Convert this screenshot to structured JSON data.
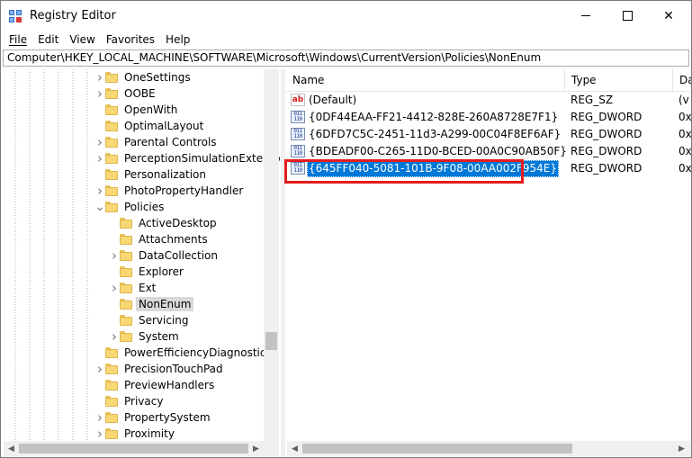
{
  "window": {
    "title": "Registry Editor",
    "icons": {
      "app": "registry-editor-icon",
      "minimize": "minimize-icon",
      "maximize": "maximize-icon",
      "close": "close-icon"
    },
    "close_glyph": "✕"
  },
  "menu": {
    "items": [
      {
        "label": "File",
        "key": "F"
      },
      {
        "label": "Edit",
        "key": "E"
      },
      {
        "label": "View",
        "key": "V"
      },
      {
        "label": "Favorites",
        "key": "a"
      },
      {
        "label": "Help",
        "key": "H"
      }
    ]
  },
  "address": {
    "path": "Computer\\HKEY_LOCAL_MACHINE\\SOFTWARE\\Microsoft\\Windows\\CurrentVersion\\Policies\\NonEnum"
  },
  "tree": {
    "items": [
      {
        "label": "OneSettings",
        "depth": 0,
        "expander": "right"
      },
      {
        "label": "OOBE",
        "depth": 0,
        "expander": "right"
      },
      {
        "label": "OpenWith",
        "depth": 0,
        "expander": "none"
      },
      {
        "label": "OptimalLayout",
        "depth": 0,
        "expander": "none"
      },
      {
        "label": "Parental Controls",
        "depth": 0,
        "expander": "right"
      },
      {
        "label": "PerceptionSimulationExtensions",
        "depth": 0,
        "expander": "right"
      },
      {
        "label": "Personalization",
        "depth": 0,
        "expander": "none"
      },
      {
        "label": "PhotoPropertyHandler",
        "depth": 0,
        "expander": "right"
      },
      {
        "label": "Policies",
        "depth": 0,
        "expander": "down"
      },
      {
        "label": "ActiveDesktop",
        "depth": 1,
        "expander": "none"
      },
      {
        "label": "Attachments",
        "depth": 1,
        "expander": "none"
      },
      {
        "label": "DataCollection",
        "depth": 1,
        "expander": "right"
      },
      {
        "label": "Explorer",
        "depth": 1,
        "expander": "none"
      },
      {
        "label": "Ext",
        "depth": 1,
        "expander": "right"
      },
      {
        "label": "NonEnum",
        "depth": 1,
        "expander": "none",
        "selected": true
      },
      {
        "label": "Servicing",
        "depth": 1,
        "expander": "none"
      },
      {
        "label": "System",
        "depth": 1,
        "expander": "right"
      },
      {
        "label": "PowerEfficiencyDiagnostics",
        "depth": 0,
        "expander": "none"
      },
      {
        "label": "PrecisionTouchPad",
        "depth": 0,
        "expander": "right"
      },
      {
        "label": "PreviewHandlers",
        "depth": 0,
        "expander": "none"
      },
      {
        "label": "Privacy",
        "depth": 0,
        "expander": "none"
      },
      {
        "label": "PropertySystem",
        "depth": 0,
        "expander": "right"
      },
      {
        "label": "Proximity",
        "depth": 0,
        "expander": "right"
      }
    ]
  },
  "list": {
    "columns": [
      "Name",
      "Type",
      "Da"
    ],
    "rows": [
      {
        "name": "(Default)",
        "type": "REG_SZ",
        "data": "(v",
        "icon": "string-value-icon",
        "icon_text": "ab"
      },
      {
        "name": "{0DF44EAA-FF21-4412-828E-260A8728E7F1}",
        "type": "REG_DWORD",
        "data": "0x",
        "icon": "binary-value-icon",
        "icon_text": "011 110"
      },
      {
        "name": "{6DFD7C5C-2451-11d3-A299-00C04F8EF6AF}",
        "type": "REG_DWORD",
        "data": "0x",
        "icon": "binary-value-icon",
        "icon_text": "011 110"
      },
      {
        "name": "{BDEADF00-C265-11D0-BCED-00A0C90AB50F}",
        "type": "REG_DWORD",
        "data": "0x",
        "icon": "binary-value-icon",
        "icon_text": "011 110"
      },
      {
        "name": "{645FF040-5081-101B-9F08-00AA002F954E}",
        "type": "REG_DWORD",
        "data": "0x",
        "icon": "binary-value-icon",
        "icon_text": "011 110",
        "selected": true
      }
    ]
  },
  "colors": {
    "selection": "#0078d7",
    "highlight_border": "#e51c1c",
    "folder": "#f8d775"
  }
}
